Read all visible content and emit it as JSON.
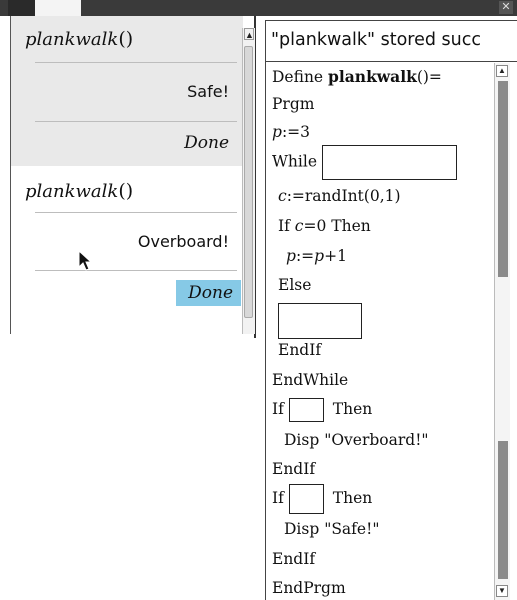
{
  "calculator": {
    "entries": [
      {
        "command": "plankwalk",
        "parens": "()",
        "output": "Safe!",
        "result": "Done"
      },
      {
        "command": "plankwalk",
        "parens": "()",
        "output": "Overboard!",
        "result": "Done"
      }
    ]
  },
  "editor": {
    "status_message": "\"plankwalk\" stored succ",
    "lines": {
      "define": "Define ",
      "define_name": "plankwalk",
      "define_tail": "()=",
      "prgm": "Prgm",
      "p_var": "p",
      "p_assign": ":=3",
      "while": "While",
      "c_var": "c",
      "c_assign": ":=randInt(0,1)",
      "if_c": "If ",
      "if_c_var": "c",
      "if_c_tail": "=0 Then",
      "p_inc_var": "p",
      "p_inc_mid": ":=",
      "p_inc_var2": "p",
      "p_inc_tail": "+1",
      "else": "Else",
      "endif1": "EndIf",
      "endwhile": "EndWhile",
      "if2": "If",
      "then2": "Then",
      "disp_overboard": "Disp \"Overboard!\"",
      "endif2": "EndIf",
      "if3": "If",
      "then3": "Then",
      "disp_safe": "Disp \"Safe!\"",
      "endif3": "EndIf",
      "endprgm": "EndPrgm"
    }
  },
  "colors": {
    "highlight": "#86c9e6",
    "shaded_entry": "#e9e9e9",
    "titlebar": "#3a3a3a"
  },
  "icons": [
    "close-icon",
    "scroll-up-icon",
    "scroll-down-icon",
    "mouse-cursor-icon"
  ]
}
